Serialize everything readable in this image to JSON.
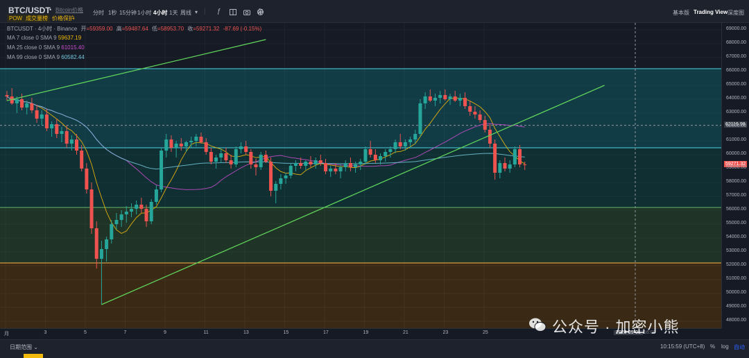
{
  "header": {
    "symbol": "BTC/USDT",
    "symbol_dot": "•",
    "symbol_link": "Bitcoin价格",
    "chips": [
      "POW",
      "成交量榜",
      "价格保护",
      "›"
    ],
    "timeframes": [
      "分时",
      "1秒",
      "15分钟",
      "1小时",
      "4小时",
      "1天",
      "周线"
    ],
    "active_timeframe": "4小时",
    "tools": [
      "dropdown-icon",
      "indicator-icon",
      "layout-icon",
      "camera-icon",
      "add-icon",
      "settings-icon"
    ],
    "right_tabs": [
      "基本版",
      "Trading View",
      "深度图"
    ],
    "active_right_tab": "Trading View"
  },
  "legend": {
    "title": "BTCUSDT · 4小时 · Binance",
    "ohlc": [
      {
        "k": "开",
        "v": "=59359.00"
      },
      {
        "k": "高",
        "v": "=59487.64"
      },
      {
        "k": "低",
        "v": "=58953.70"
      },
      {
        "k": "收",
        "v": "=59271.32"
      }
    ],
    "change": "-87.69 (-0.15%)",
    "ma": [
      {
        "label": "MA 7 close 0 SMA 9",
        "value": "59637.19",
        "color": "#f0b90b"
      },
      {
        "label": "MA 25 close 0 SMA 9",
        "value": "61015.40",
        "color": "#c94ecb"
      },
      {
        "label": "MA 99 close 0 SMA 9",
        "value": "60582.44",
        "color": "#73c7db"
      }
    ]
  },
  "price_axis": [
    "69000.00",
    "68000.00",
    "67000.00",
    "66000.00",
    "65000.00",
    "64000.00",
    "63000.00",
    "62000.00",
    "61000.00",
    "60000.00",
    "59000.00",
    "58000.00",
    "57000.00",
    "56000.00",
    "55000.00",
    "54000.00",
    "53000.00",
    "52000.00",
    "51000.00",
    "50000.00",
    "49000.00",
    "48000.00"
  ],
  "tags": {
    "crosshair": "62116.98",
    "last": "59271.32"
  },
  "time_axis": [
    "月",
    "3",
    "5",
    "7",
    "9",
    "11",
    "13",
    "15",
    "17",
    "19",
    "21",
    "23",
    "25"
  ],
  "time_cursor": "2024-09-01",
  "time_cursor_tail": "16:00",
  "footer": {
    "range": "日期范围",
    "clock": "10:15:59 (UTC+8)",
    "pct": "%",
    "log": "log",
    "auto": "自动"
  },
  "watermark": "公众号 · 加密小熊",
  "logo": "17",
  "colors": {
    "up": "#26a69a",
    "down": "#ef5350",
    "ma7": "#f0b90b",
    "ma25": "#c94ecb",
    "ma99": "#73c7db",
    "trend": "#5fd35a",
    "accent": "#2962ff"
  },
  "chart_data": {
    "type": "candlestick",
    "ylim": [
      47500,
      69500
    ],
    "levels": [
      66200,
      60500,
      56200,
      52200
    ],
    "zones": [
      {
        "from": 66200,
        "to": 60500,
        "color": "teal"
      },
      {
        "from": 60500,
        "to": 56200,
        "color": "dark-teal"
      },
      {
        "from": 56200,
        "to": 52200,
        "color": "olive"
      },
      {
        "from": 52200,
        "to": 47500,
        "color": "brown"
      }
    ],
    "candles": [
      [
        64300,
        64600,
        63900,
        64200
      ],
      [
        64200,
        64800,
        63600,
        63700
      ],
      [
        63700,
        64200,
        63000,
        64000
      ],
      [
        64000,
        64400,
        63200,
        63400
      ],
      [
        63400,
        63900,
        62900,
        63700
      ],
      [
        63700,
        64100,
        63000,
        63200
      ],
      [
        63200,
        63600,
        62300,
        62600
      ],
      [
        62600,
        63200,
        62100,
        62900
      ],
      [
        62900,
        63300,
        61700,
        61900
      ],
      [
        61900,
        62400,
        61300,
        62200
      ],
      [
        62200,
        62600,
        61200,
        61500
      ],
      [
        61500,
        62000,
        60900,
        61700
      ],
      [
        61700,
        62100,
        60500,
        60800
      ],
      [
        60800,
        61400,
        60300,
        61100
      ],
      [
        61100,
        61500,
        60000,
        60300
      ],
      [
        60300,
        60700,
        58800,
        59000
      ],
      [
        59000,
        59400,
        57200,
        57500
      ],
      [
        57500,
        58000,
        54300,
        54700
      ],
      [
        54700,
        55200,
        51800,
        52500
      ],
      [
        52500,
        53800,
        49200,
        53200
      ],
      [
        53200,
        54100,
        52300,
        53900
      ],
      [
        53900,
        55300,
        53600,
        55000
      ],
      [
        55000,
        55800,
        54600,
        55300
      ],
      [
        55300,
        56000,
        54800,
        55700
      ],
      [
        55700,
        56300,
        55100,
        55900
      ],
      [
        55900,
        56500,
        55500,
        56100
      ],
      [
        56100,
        56700,
        55700,
        56400
      ],
      [
        56400,
        56900,
        55800,
        56100
      ],
      [
        56100,
        56400,
        54800,
        55200
      ],
      [
        55200,
        56800,
        55000,
        56600
      ],
      [
        56600,
        57800,
        56400,
        57500
      ],
      [
        57500,
        60500,
        57300,
        60300
      ],
      [
        60300,
        61500,
        59800,
        61100
      ],
      [
        61100,
        61400,
        60200,
        60500
      ],
      [
        60500,
        61000,
        59800,
        60800
      ],
      [
        60800,
        61200,
        60300,
        60600
      ],
      [
        60600,
        61000,
        60200,
        60900
      ],
      [
        60900,
        61300,
        60500,
        61000
      ],
      [
        61000,
        61500,
        60600,
        61300
      ],
      [
        61300,
        61600,
        60800,
        60900
      ],
      [
        60900,
        61200,
        60000,
        60200
      ],
      [
        60200,
        60500,
        59300,
        59500
      ],
      [
        59500,
        60000,
        59000,
        59800
      ],
      [
        59800,
        60400,
        59400,
        60100
      ],
      [
        60100,
        60500,
        59400,
        59600
      ],
      [
        59600,
        60000,
        59000,
        59300
      ],
      [
        59300,
        60600,
        59100,
        60400
      ],
      [
        60400,
        60900,
        60100,
        60600
      ],
      [
        60600,
        61000,
        60000,
        60200
      ],
      [
        60200,
        60400,
        59000,
        59300
      ],
      [
        59300,
        59700,
        58500,
        59100
      ],
      [
        59100,
        60200,
        58900,
        60000
      ],
      [
        60000,
        60300,
        59400,
        59500
      ],
      [
        59500,
        59800,
        57000,
        57400
      ],
      [
        57400,
        58100,
        56500,
        57900
      ],
      [
        57900,
        58600,
        57500,
        58300
      ],
      [
        58300,
        58700,
        57900,
        58500
      ],
      [
        58500,
        59400,
        58300,
        59200
      ],
      [
        59200,
        59600,
        58800,
        59400
      ],
      [
        59400,
        59800,
        59000,
        59200
      ],
      [
        59200,
        59600,
        58900,
        59500
      ],
      [
        59500,
        59900,
        59100,
        59300
      ],
      [
        59300,
        59800,
        59000,
        59600
      ],
      [
        59600,
        60000,
        59200,
        59400
      ],
      [
        59400,
        59700,
        58600,
        58800
      ],
      [
        58800,
        59200,
        58400,
        59000
      ],
      [
        59000,
        59400,
        58600,
        58800
      ],
      [
        58800,
        59300,
        58300,
        59100
      ],
      [
        59100,
        59600,
        58800,
        59400
      ],
      [
        59400,
        59800,
        58800,
        59100
      ],
      [
        59100,
        59500,
        58700,
        59300
      ],
      [
        59300,
        59700,
        58900,
        59500
      ],
      [
        59500,
        60600,
        59300,
        60400
      ],
      [
        60400,
        61000,
        59800,
        60000
      ],
      [
        60000,
        60400,
        59400,
        59600
      ],
      [
        59600,
        60100,
        59300,
        59900
      ],
      [
        59900,
        60400,
        59500,
        60200
      ],
      [
        60200,
        60600,
        59800,
        60400
      ],
      [
        60400,
        61100,
        60100,
        60900
      ],
      [
        60900,
        61500,
        60400,
        60600
      ],
      [
        60600,
        61100,
        60300,
        60900
      ],
      [
        60900,
        61300,
        60500,
        61100
      ],
      [
        61100,
        61800,
        60800,
        61500
      ],
      [
        61500,
        64000,
        61300,
        63700
      ],
      [
        63700,
        64500,
        63300,
        64200
      ],
      [
        64200,
        64700,
        63800,
        63900
      ],
      [
        63900,
        64400,
        63500,
        64100
      ],
      [
        64100,
        64600,
        63700,
        64300
      ],
      [
        64300,
        64700,
        63900,
        64000
      ],
      [
        64000,
        64400,
        63600,
        64200
      ],
      [
        64200,
        64600,
        63800,
        63900
      ],
      [
        63900,
        64400,
        63500,
        64100
      ],
      [
        64100,
        64500,
        63300,
        63500
      ],
      [
        63500,
        63900,
        62800,
        63100
      ],
      [
        63100,
        63500,
        62600,
        62900
      ],
      [
        62900,
        63200,
        62300,
        62500
      ],
      [
        62500,
        62800,
        61600,
        61800
      ],
      [
        61800,
        62200,
        60500,
        60800
      ],
      [
        60800,
        61100,
        58200,
        58700
      ],
      [
        58700,
        59600,
        58300,
        59400
      ],
      [
        59400,
        59800,
        58800,
        59000
      ],
      [
        59000,
        59600,
        58700,
        59300
      ],
      [
        59300,
        60600,
        59100,
        60400
      ],
      [
        60400,
        60700,
        59100,
        59300
      ],
      [
        59300,
        59500,
        58900,
        59270
      ]
    ],
    "trendlines": [
      {
        "from": [
          0,
          63900
        ],
        "to": [
          52,
          68300
        ]
      },
      {
        "from": [
          19,
          49200
        ],
        "to": [
          120,
          65000
        ]
      }
    ]
  }
}
